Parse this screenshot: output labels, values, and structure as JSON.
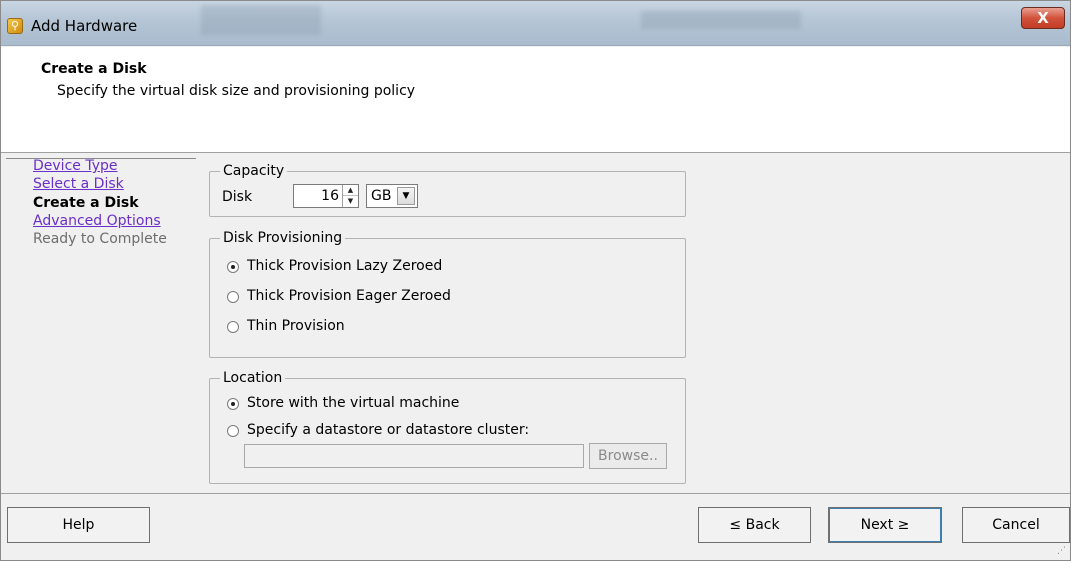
{
  "window": {
    "title": "Add Hardware",
    "close_label": "X"
  },
  "header": {
    "title": "Create a Disk",
    "subtitle": "Specify the virtual disk size and provisioning policy"
  },
  "nav": {
    "items": [
      {
        "label": "Device Type",
        "state": "link"
      },
      {
        "label": "Select a Disk",
        "state": "link"
      },
      {
        "label": "Create a Disk",
        "state": "current"
      },
      {
        "label": "Advanced Options",
        "state": "link"
      },
      {
        "label": "Ready to Complete",
        "state": "disabled"
      }
    ]
  },
  "capacity": {
    "legend": "Capacity",
    "disk_label": "Disk",
    "disk_size": "16",
    "unit": "GB"
  },
  "provisioning": {
    "legend": "Disk Provisioning",
    "options": [
      {
        "label": "Thick Provision Lazy Zeroed",
        "checked": true
      },
      {
        "label": "Thick Provision Eager Zeroed",
        "checked": false
      },
      {
        "label": "Thin Provision",
        "checked": false
      }
    ]
  },
  "location": {
    "legend": "Location",
    "options": [
      {
        "label": "Store with the virtual machine",
        "checked": true
      },
      {
        "label": "Specify a datastore or datastore cluster:",
        "checked": false
      }
    ],
    "path_value": "",
    "browse_label": "Browse.."
  },
  "footer": {
    "help": "Help",
    "back": "≤ Back",
    "next": "Next ≥",
    "cancel": "Cancel"
  }
}
